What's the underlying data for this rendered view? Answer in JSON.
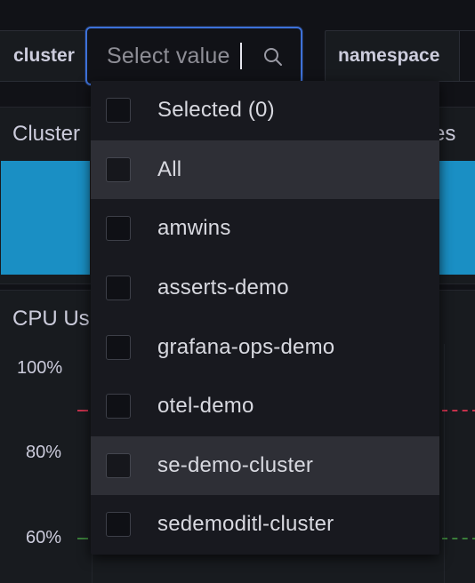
{
  "variables": {
    "cluster_label": "cluster",
    "cluster_placeholder": "Select value",
    "namespace_label": "namespace"
  },
  "panels": {
    "cluster_title": "Cluster",
    "right_title_fragment": "es",
    "cpu_title": "CPU Us",
    "cpu_axis": [
      "100%",
      "80%",
      "60%"
    ]
  },
  "dropdown": {
    "options": [
      {
        "label": "Selected (0)",
        "checked": false
      },
      {
        "label": "All",
        "checked": false
      },
      {
        "label": "amwins",
        "checked": false
      },
      {
        "label": "asserts-demo",
        "checked": false
      },
      {
        "label": "grafana-ops-demo",
        "checked": false
      },
      {
        "label": "otel-demo",
        "checked": false
      },
      {
        "label": "se-demo-cluster",
        "checked": false
      },
      {
        "label": "sedemoditl-cluster",
        "checked": false
      }
    ]
  },
  "colors": {
    "accent": "#3d71d9",
    "stat_blue": "#1a8fc4",
    "threshold_red": "#c4314b",
    "threshold_green": "#3a7d3a"
  }
}
